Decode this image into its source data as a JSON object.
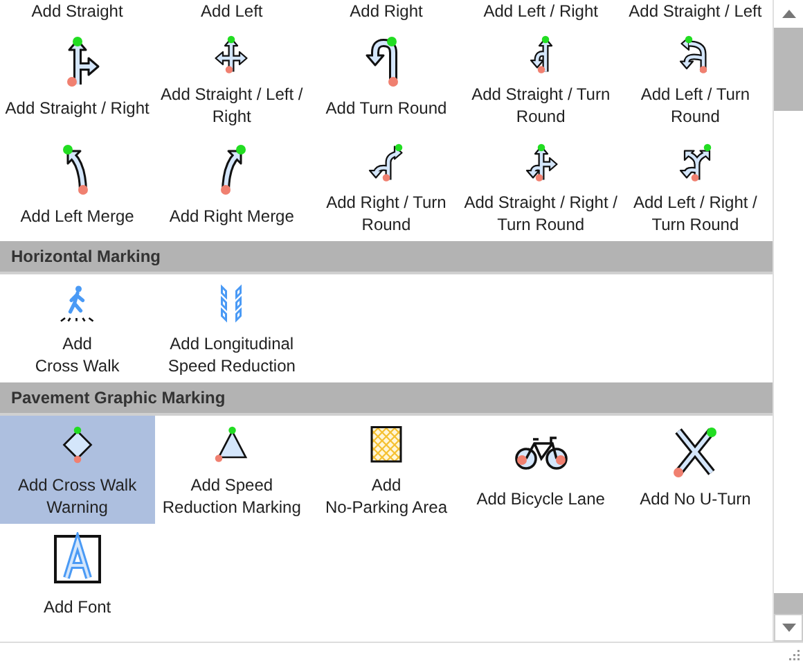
{
  "sections": [
    {
      "items": [
        {
          "label": "Add Straight",
          "selected": false,
          "kind": "cut"
        },
        {
          "label": "Add Left",
          "selected": false,
          "kind": "cut"
        },
        {
          "label": "Add Right",
          "selected": false,
          "kind": "cut"
        },
        {
          "label": "Add Left / Right",
          "selected": false,
          "kind": "cut"
        },
        {
          "label": "Add Straight / Left",
          "selected": false,
          "kind": "cut"
        },
        {
          "label": "Add Straight / Right",
          "selected": false,
          "kind": "tool"
        },
        {
          "label": "Add Straight / Left / Right",
          "selected": false,
          "kind": "tool"
        },
        {
          "label": "Add Turn Round",
          "selected": false,
          "kind": "tool"
        },
        {
          "label": "Add Straight / Turn Round",
          "selected": false,
          "kind": "tool"
        },
        {
          "label": "Add Left / Turn Round",
          "selected": false,
          "kind": "tool"
        },
        {
          "label": "Add Left Merge",
          "selected": false,
          "kind": "tool"
        },
        {
          "label": "Add Right Merge",
          "selected": false,
          "kind": "tool"
        },
        {
          "label": "Add Right / Turn Round",
          "selected": false,
          "kind": "tool"
        },
        {
          "label": "Add Straight / Right / Turn Round",
          "selected": false,
          "kind": "tool"
        },
        {
          "label": "Add Left / Right / Turn Round",
          "selected": false,
          "kind": "tool"
        }
      ]
    },
    {
      "title": "Horizontal Marking",
      "items": [
        {
          "label": "Add\nCross Walk",
          "selected": false,
          "kind": "tool"
        },
        {
          "label": "Add Longitudinal Speed Reduction",
          "selected": false,
          "kind": "tool"
        }
      ]
    },
    {
      "title": "Pavement Graphic Marking",
      "items": [
        {
          "label": "Add Cross Walk Warning",
          "selected": true,
          "kind": "tool"
        },
        {
          "label": "Add Speed Reduction Marking",
          "selected": false,
          "kind": "tool"
        },
        {
          "label": "Add\nNo-Parking Area",
          "selected": false,
          "kind": "tool"
        },
        {
          "label": "Add Bicycle Lane",
          "selected": false,
          "kind": "tool"
        },
        {
          "label": "Add No U-Turn",
          "selected": false,
          "kind": "tool"
        },
        {
          "label": "Add Font",
          "selected": false,
          "kind": "tool"
        }
      ]
    }
  ]
}
